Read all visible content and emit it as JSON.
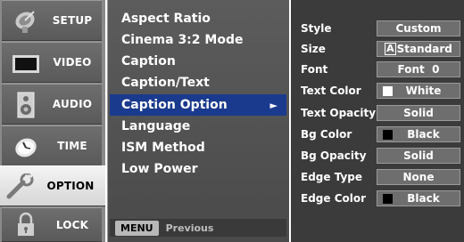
{
  "categories": [
    {
      "id": "setup",
      "label": "SETUP",
      "icon": "satellite-dish-icon",
      "selected": false
    },
    {
      "id": "video",
      "label": "VIDEO",
      "icon": "tv-screen-icon",
      "selected": false
    },
    {
      "id": "audio",
      "label": "AUDIO",
      "icon": "speaker-icon",
      "selected": false
    },
    {
      "id": "time",
      "label": "TIME",
      "icon": "clock-icon",
      "selected": false
    },
    {
      "id": "option",
      "label": "OPTION",
      "icon": "option-wrench-icon",
      "selected": true
    },
    {
      "id": "lock",
      "label": "LOCK",
      "icon": "padlock-icon",
      "selected": false
    }
  ],
  "menu": {
    "items": [
      {
        "label": "Aspect Ratio",
        "selected": false
      },
      {
        "label": "Cinema 3:2 Mode",
        "selected": false
      },
      {
        "label": "Caption",
        "selected": false
      },
      {
        "label": "Caption/Text",
        "selected": false
      },
      {
        "label": "Caption Option",
        "selected": true,
        "arrow": "►"
      },
      {
        "label": "Language",
        "selected": false
      },
      {
        "label": "ISM Method",
        "selected": false
      },
      {
        "label": "Low Power",
        "selected": false
      }
    ],
    "footer": {
      "key_label": "MENU",
      "hint": "Previous"
    }
  },
  "caption_options": [
    {
      "label": "Style",
      "value": "Custom"
    },
    {
      "label": "Size",
      "value_prefix": "A",
      "value": "Standard"
    },
    {
      "label": "Font",
      "value": "Font  0"
    },
    {
      "label": "Text Color",
      "value": "White",
      "swatch": "#ffffff"
    },
    {
      "label": "Text Opacity",
      "value": "Solid"
    },
    {
      "label": "Bg Color",
      "value": "Black",
      "swatch": "#000000"
    },
    {
      "label": "Bg Opacity",
      "value": "Solid"
    },
    {
      "label": "Edge Type",
      "value": "None"
    },
    {
      "label": "Edge Color",
      "value": "Black",
      "swatch": "#000000"
    }
  ],
  "colors": {
    "selection_highlight": "#1a3a8e",
    "menu_background": "#4f4f4f",
    "options_background": "#3b3b3b"
  }
}
